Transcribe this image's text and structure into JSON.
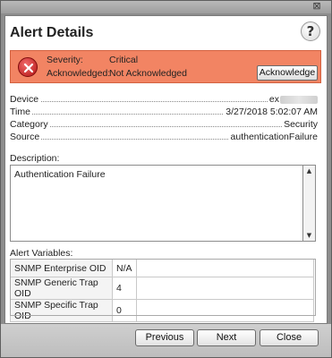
{
  "window": {
    "close_glyph": "⊠"
  },
  "dialog": {
    "title": "Alert Details",
    "help_glyph": "?"
  },
  "alert": {
    "severity_label": "Severity:",
    "severity_value": "Critical",
    "ack_label": "Acknowledged:",
    "ack_value": "Not Acknowledged",
    "ack_button": "Acknowledge",
    "status_color": "#f28463"
  },
  "info": {
    "device_label": "Device",
    "device_value": "ex",
    "time_label": "Time",
    "time_value": "3/27/2018 5:02:07 AM",
    "category_label": "Category",
    "category_value": "Security",
    "source_label": "Source",
    "source_value": "authenticationFailure"
  },
  "description": {
    "label": "Description:",
    "text": "Authentication Failure"
  },
  "variables": {
    "label": "Alert Variables:",
    "rows": [
      {
        "name": "SNMP Enterprise OID",
        "value": "N/A"
      },
      {
        "name": "SNMP Generic Trap OID",
        "value": "4"
      },
      {
        "name": "SNMP Specific Trap OID",
        "value": "0"
      }
    ]
  },
  "footer": {
    "previous": "Previous",
    "next": "Next",
    "close": "Close"
  }
}
